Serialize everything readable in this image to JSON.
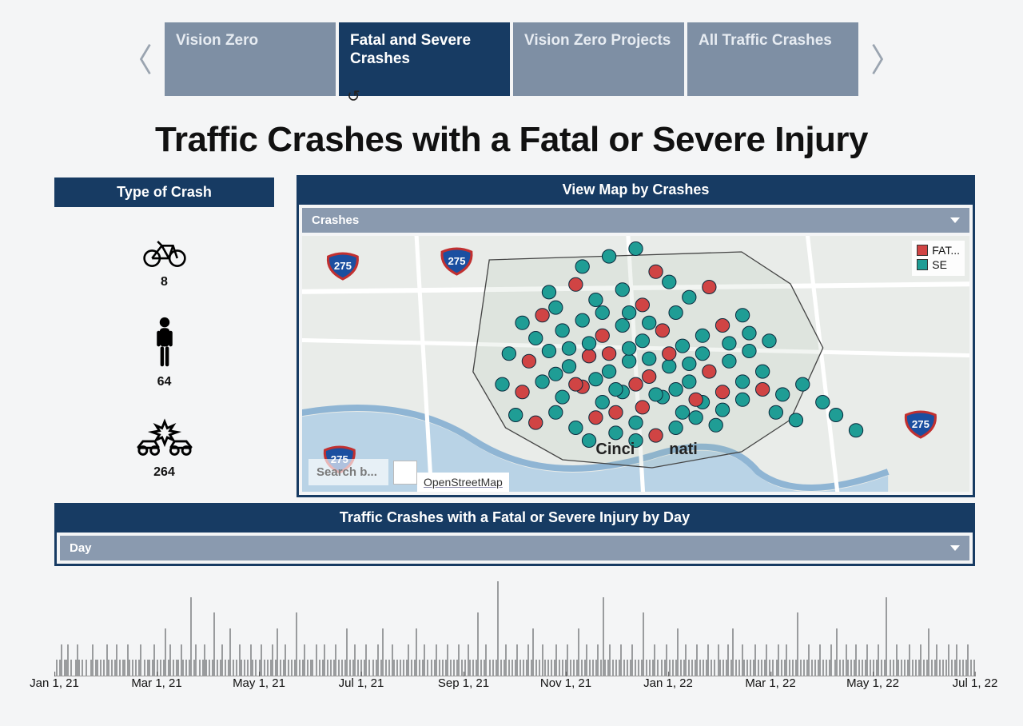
{
  "tabs": {
    "items": [
      {
        "label": "Vision Zero",
        "active": false
      },
      {
        "label": "Fatal and Severe Crashes",
        "active": true
      },
      {
        "label": "Vision Zero Projects",
        "active": false
      },
      {
        "label": "All Traffic Crashes",
        "active": false
      }
    ]
  },
  "title": "Traffic Crashes with a Fatal or Severe Injury",
  "left": {
    "header": "Type of Crash",
    "types": [
      {
        "icon": "bike",
        "count": "8"
      },
      {
        "icon": "pedestrian",
        "count": "64"
      },
      {
        "icon": "vehicle",
        "count": "264"
      }
    ]
  },
  "map_panel": {
    "header": "View Map by Crashes",
    "dropdown_label": "Crashes",
    "legend": [
      {
        "color": "#d04444",
        "label": "FAT..."
      },
      {
        "color": "#1f9d95",
        "label": "SE"
      }
    ],
    "search_placeholder": "Search b...",
    "attribution": "OpenStreetMap",
    "city_label_left": "Cinci",
    "city_label_right": "nati",
    "highway_shields": [
      "275",
      "275",
      "275",
      "275"
    ]
  },
  "timeline_panel": {
    "header": "Traffic Crashes with a Fatal or Severe Injury by Day",
    "dropdown_label": "Day"
  },
  "chart_data": {
    "type": "bar",
    "xlabel": "",
    "ylabel": "",
    "x_start": "2021-01-01",
    "x_end": "2022-07-31",
    "x_ticks": [
      "Jan 1, 21",
      "Mar 1, 21",
      "May 1, 21",
      "Jul 1, 21",
      "Sep 1, 21",
      "Nov 1, 21",
      "Jan 1, 22",
      "Mar 1, 22",
      "May 1, 22",
      "Jul 1, 22"
    ],
    "ylim": [
      0,
      6
    ],
    "series": [
      {
        "name": "crashes_per_day",
        "values": [
          0,
          1,
          0,
          1,
          2,
          0,
          1,
          1,
          2,
          0,
          1,
          0,
          0,
          1,
          2,
          1,
          0,
          1,
          0,
          1,
          0,
          0,
          1,
          2,
          0,
          1,
          1,
          0,
          1,
          0,
          1,
          0,
          2,
          1,
          0,
          1,
          0,
          1,
          2,
          0,
          1,
          0,
          1,
          1,
          0,
          2,
          1,
          0,
          1,
          0,
          1,
          0,
          1,
          2,
          0,
          1,
          0,
          1,
          1,
          0,
          1,
          2,
          0,
          1,
          0,
          1,
          0,
          1,
          3,
          0,
          1,
          2,
          0,
          1,
          0,
          1,
          1,
          0,
          2,
          1,
          0,
          1,
          0,
          1,
          5,
          0,
          1,
          2,
          0,
          1,
          0,
          1,
          2,
          1,
          0,
          1,
          0,
          1,
          4,
          0,
          1,
          0,
          1,
          2,
          0,
          1,
          0,
          1,
          3,
          0,
          1,
          0,
          1,
          0,
          2,
          1,
          0,
          1,
          0,
          1,
          0,
          2,
          1,
          0,
          1,
          0,
          1,
          2,
          0,
          1,
          0,
          1,
          0,
          1,
          2,
          0,
          1,
          3,
          0,
          1,
          0,
          1,
          2,
          0,
          1,
          0,
          1,
          0,
          1,
          4,
          0,
          1,
          0,
          1,
          2,
          0,
          1,
          0,
          1,
          1,
          0,
          2,
          0,
          1,
          0,
          1,
          2,
          0,
          1,
          0,
          1,
          0,
          1,
          2,
          0,
          1,
          0,
          1,
          0,
          1,
          3,
          0,
          1,
          0,
          1,
          2,
          0,
          1,
          0,
          1,
          0,
          1,
          2,
          0,
          1,
          0,
          1,
          0,
          1,
          2,
          0,
          1,
          3,
          0,
          1,
          0,
          1,
          0,
          2,
          1,
          0,
          1,
          0,
          1,
          0,
          1,
          0,
          1,
          2,
          0,
          1,
          0,
          1,
          3,
          0,
          1,
          0,
          1,
          2,
          0,
          1,
          0,
          1,
          0,
          1,
          2,
          0,
          1,
          0,
          1,
          0,
          1,
          2,
          0,
          1,
          0,
          1,
          0,
          1,
          2,
          0,
          1,
          0,
          1,
          0,
          2,
          1,
          0,
          1,
          0,
          1,
          4,
          0,
          1,
          0,
          1,
          2,
          0,
          1,
          0,
          1,
          0,
          1,
          6,
          0,
          1,
          0,
          1,
          2,
          0,
          1,
          0,
          1,
          0,
          1,
          2,
          0,
          1,
          0,
          1,
          0,
          1,
          2,
          0,
          1,
          3,
          0,
          1,
          0,
          1,
          0,
          2,
          1,
          0,
          1,
          0,
          1,
          0,
          1,
          2,
          0,
          1,
          0,
          1,
          0,
          1,
          2,
          0,
          1,
          0,
          1,
          0,
          1,
          3,
          0,
          1,
          0,
          1,
          2,
          0,
          1,
          0,
          1,
          0,
          1,
          2,
          0,
          1,
          5,
          1,
          0,
          1,
          2,
          0,
          1,
          0,
          1,
          0,
          1,
          2,
          0,
          1,
          0,
          1,
          0,
          1,
          2,
          0,
          1,
          0,
          1,
          0,
          1,
          4,
          0,
          1,
          0,
          1,
          0,
          1,
          2,
          0,
          1,
          0,
          1,
          0,
          1,
          2,
          0,
          1,
          0,
          1,
          0,
          1,
          3,
          0,
          1,
          0,
          1,
          2,
          0,
          1,
          0,
          1,
          0,
          1,
          2,
          0,
          1,
          0,
          1,
          0,
          1,
          2,
          0,
          1,
          0,
          1,
          0,
          2,
          1,
          0,
          1,
          0,
          1,
          2,
          0,
          1,
          3,
          0,
          1,
          0,
          1,
          0,
          2,
          1,
          0,
          1,
          0,
          1,
          0,
          1,
          2,
          0,
          1,
          0,
          1,
          0,
          1,
          2,
          0,
          1,
          0,
          1,
          0,
          1,
          2,
          0,
          1,
          0,
          1,
          2,
          0,
          1,
          0,
          1,
          0,
          1,
          4,
          0,
          1,
          0,
          1,
          0,
          1,
          2,
          0,
          1,
          0,
          1,
          0,
          1,
          2,
          0,
          1,
          0,
          1,
          0,
          1,
          2,
          0,
          1,
          3,
          0,
          1,
          0,
          1,
          0,
          2,
          1,
          0,
          1,
          0,
          1,
          2,
          0,
          1,
          0,
          1,
          0,
          1,
          2,
          0,
          1,
          0,
          1,
          0,
          1,
          2,
          0,
          1,
          0,
          1,
          5,
          0,
          1,
          0,
          1,
          0,
          2,
          1,
          0,
          1,
          0,
          1,
          0,
          1,
          2,
          0,
          1,
          0,
          1,
          0,
          1,
          2,
          0,
          1,
          0,
          1,
          3,
          0,
          1,
          0,
          1,
          2,
          0,
          1,
          0,
          1,
          0,
          1,
          2,
          0,
          1,
          0,
          1,
          2,
          0,
          1,
          0,
          1,
          0,
          1,
          2,
          0,
          1,
          0,
          1
        ]
      }
    ],
    "map_points": [
      {
        "x": 0.42,
        "y": 0.12,
        "c": "t"
      },
      {
        "x": 0.46,
        "y": 0.08,
        "c": "t"
      },
      {
        "x": 0.5,
        "y": 0.05,
        "c": "t"
      },
      {
        "x": 0.53,
        "y": 0.14,
        "c": "r"
      },
      {
        "x": 0.37,
        "y": 0.22,
        "c": "t"
      },
      {
        "x": 0.41,
        "y": 0.19,
        "c": "r"
      },
      {
        "x": 0.44,
        "y": 0.25,
        "c": "t"
      },
      {
        "x": 0.48,
        "y": 0.21,
        "c": "t"
      },
      {
        "x": 0.51,
        "y": 0.27,
        "c": "r"
      },
      {
        "x": 0.55,
        "y": 0.18,
        "c": "t"
      },
      {
        "x": 0.58,
        "y": 0.24,
        "c": "t"
      },
      {
        "x": 0.61,
        "y": 0.2,
        "c": "r"
      },
      {
        "x": 0.33,
        "y": 0.34,
        "c": "t"
      },
      {
        "x": 0.36,
        "y": 0.31,
        "c": "r"
      },
      {
        "x": 0.39,
        "y": 0.37,
        "c": "t"
      },
      {
        "x": 0.42,
        "y": 0.33,
        "c": "t"
      },
      {
        "x": 0.45,
        "y": 0.39,
        "c": "r"
      },
      {
        "x": 0.48,
        "y": 0.35,
        "c": "t"
      },
      {
        "x": 0.51,
        "y": 0.41,
        "c": "t"
      },
      {
        "x": 0.54,
        "y": 0.37,
        "c": "r"
      },
      {
        "x": 0.57,
        "y": 0.43,
        "c": "t"
      },
      {
        "x": 0.6,
        "y": 0.39,
        "c": "t"
      },
      {
        "x": 0.63,
        "y": 0.35,
        "c": "r"
      },
      {
        "x": 0.66,
        "y": 0.31,
        "c": "t"
      },
      {
        "x": 0.31,
        "y": 0.46,
        "c": "t"
      },
      {
        "x": 0.34,
        "y": 0.49,
        "c": "r"
      },
      {
        "x": 0.37,
        "y": 0.45,
        "c": "t"
      },
      {
        "x": 0.4,
        "y": 0.51,
        "c": "t"
      },
      {
        "x": 0.43,
        "y": 0.47,
        "c": "r"
      },
      {
        "x": 0.46,
        "y": 0.53,
        "c": "t"
      },
      {
        "x": 0.49,
        "y": 0.49,
        "c": "t"
      },
      {
        "x": 0.52,
        "y": 0.55,
        "c": "r"
      },
      {
        "x": 0.55,
        "y": 0.51,
        "c": "t"
      },
      {
        "x": 0.58,
        "y": 0.57,
        "c": "t"
      },
      {
        "x": 0.61,
        "y": 0.53,
        "c": "r"
      },
      {
        "x": 0.64,
        "y": 0.49,
        "c": "t"
      },
      {
        "x": 0.67,
        "y": 0.45,
        "c": "t"
      },
      {
        "x": 0.7,
        "y": 0.41,
        "c": "t"
      },
      {
        "x": 0.3,
        "y": 0.58,
        "c": "t"
      },
      {
        "x": 0.33,
        "y": 0.61,
        "c": "r"
      },
      {
        "x": 0.36,
        "y": 0.57,
        "c": "t"
      },
      {
        "x": 0.39,
        "y": 0.63,
        "c": "t"
      },
      {
        "x": 0.42,
        "y": 0.59,
        "c": "r"
      },
      {
        "x": 0.45,
        "y": 0.65,
        "c": "t"
      },
      {
        "x": 0.48,
        "y": 0.61,
        "c": "t"
      },
      {
        "x": 0.51,
        "y": 0.67,
        "c": "r"
      },
      {
        "x": 0.54,
        "y": 0.63,
        "c": "t"
      },
      {
        "x": 0.57,
        "y": 0.69,
        "c": "t"
      },
      {
        "x": 0.6,
        "y": 0.65,
        "c": "t"
      },
      {
        "x": 0.63,
        "y": 0.61,
        "c": "r"
      },
      {
        "x": 0.66,
        "y": 0.57,
        "c": "t"
      },
      {
        "x": 0.69,
        "y": 0.53,
        "c": "t"
      },
      {
        "x": 0.32,
        "y": 0.7,
        "c": "t"
      },
      {
        "x": 0.35,
        "y": 0.73,
        "c": "r"
      },
      {
        "x": 0.38,
        "y": 0.69,
        "c": "t"
      },
      {
        "x": 0.41,
        "y": 0.75,
        "c": "t"
      },
      {
        "x": 0.44,
        "y": 0.71,
        "c": "r"
      },
      {
        "x": 0.47,
        "y": 0.77,
        "c": "t"
      },
      {
        "x": 0.5,
        "y": 0.73,
        "c": "t"
      },
      {
        "x": 0.53,
        "y": 0.78,
        "c": "r"
      },
      {
        "x": 0.56,
        "y": 0.75,
        "c": "t"
      },
      {
        "x": 0.59,
        "y": 0.71,
        "c": "t"
      },
      {
        "x": 0.62,
        "y": 0.74,
        "c": "t"
      },
      {
        "x": 0.72,
        "y": 0.62,
        "c": "t"
      },
      {
        "x": 0.75,
        "y": 0.58,
        "c": "t"
      },
      {
        "x": 0.78,
        "y": 0.65,
        "c": "t"
      },
      {
        "x": 0.74,
        "y": 0.72,
        "c": "t"
      },
      {
        "x": 0.71,
        "y": 0.69,
        "c": "t"
      },
      {
        "x": 0.8,
        "y": 0.7,
        "c": "t"
      },
      {
        "x": 0.83,
        "y": 0.76,
        "c": "t"
      },
      {
        "x": 0.4,
        "y": 0.44,
        "c": "t"
      },
      {
        "x": 0.43,
        "y": 0.42,
        "c": "t"
      },
      {
        "x": 0.46,
        "y": 0.46,
        "c": "r"
      },
      {
        "x": 0.49,
        "y": 0.44,
        "c": "t"
      },
      {
        "x": 0.52,
        "y": 0.48,
        "c": "t"
      },
      {
        "x": 0.55,
        "y": 0.46,
        "c": "r"
      },
      {
        "x": 0.58,
        "y": 0.5,
        "c": "t"
      },
      {
        "x": 0.38,
        "y": 0.54,
        "c": "t"
      },
      {
        "x": 0.41,
        "y": 0.58,
        "c": "r"
      },
      {
        "x": 0.44,
        "y": 0.56,
        "c": "t"
      },
      {
        "x": 0.47,
        "y": 0.6,
        "c": "t"
      },
      {
        "x": 0.5,
        "y": 0.58,
        "c": "r"
      },
      {
        "x": 0.53,
        "y": 0.62,
        "c": "t"
      },
      {
        "x": 0.56,
        "y": 0.6,
        "c": "t"
      },
      {
        "x": 0.59,
        "y": 0.64,
        "c": "r"
      },
      {
        "x": 0.35,
        "y": 0.4,
        "c": "t"
      },
      {
        "x": 0.38,
        "y": 0.28,
        "c": "t"
      },
      {
        "x": 0.56,
        "y": 0.3,
        "c": "t"
      },
      {
        "x": 0.64,
        "y": 0.42,
        "c": "t"
      },
      {
        "x": 0.67,
        "y": 0.38,
        "c": "t"
      },
      {
        "x": 0.49,
        "y": 0.3,
        "c": "t"
      },
      {
        "x": 0.52,
        "y": 0.34,
        "c": "t"
      },
      {
        "x": 0.45,
        "y": 0.3,
        "c": "t"
      },
      {
        "x": 0.6,
        "y": 0.46,
        "c": "t"
      },
      {
        "x": 0.63,
        "y": 0.68,
        "c": "t"
      },
      {
        "x": 0.66,
        "y": 0.64,
        "c": "t"
      },
      {
        "x": 0.69,
        "y": 0.6,
        "c": "r"
      },
      {
        "x": 0.47,
        "y": 0.69,
        "c": "r"
      },
      {
        "x": 0.5,
        "y": 0.8,
        "c": "t"
      },
      {
        "x": 0.43,
        "y": 0.8,
        "c": "t"
      }
    ]
  }
}
